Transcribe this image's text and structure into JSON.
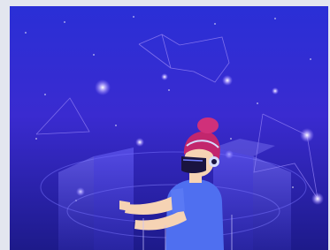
{
  "scene": {
    "subject": "vr-illustration",
    "colors": {
      "sky_top": "#2a2fd6",
      "sky_mid": "#3b28c9",
      "sky_bottom": "#1d1a8a",
      "frame": "#e3e6ef",
      "star_glow": "#b9a8ff",
      "constellation_line": "#8d7cf2",
      "hair": "#c2266d",
      "skin": "#f6d3b4",
      "shirt": "#4f6ff0",
      "headset": "#1a1440",
      "headset_band": "#d7dcff",
      "hologram": "#6a63ff"
    },
    "icons": [
      "vr-headset-icon",
      "constellation-icon",
      "star-icon"
    ]
  }
}
